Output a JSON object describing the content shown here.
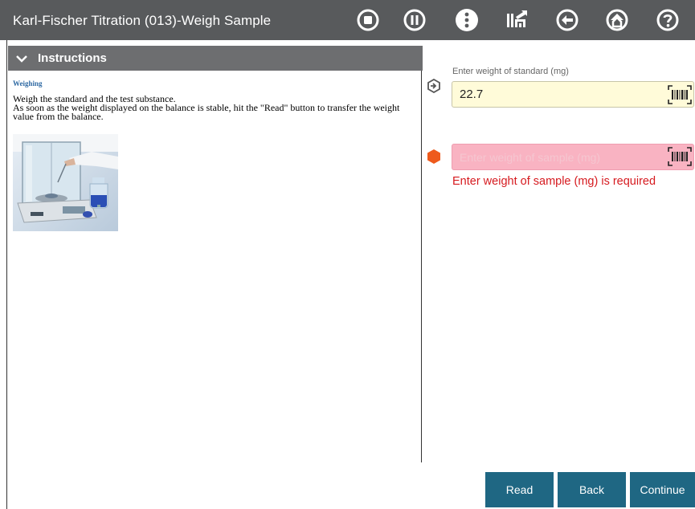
{
  "header": {
    "title": "Karl-Fischer Titration (013)-Weigh Sample",
    "icons": [
      "stop-icon",
      "pause-icon",
      "more-icon",
      "results-icon",
      "back-icon",
      "home-icon",
      "help-icon"
    ]
  },
  "instructions": {
    "header_label": "Instructions",
    "subheading": "Weighing",
    "line1": "Weigh the standard and the test substance.",
    "line2": "As soon as the weight displayed on the balance is stable, hit the \"Read\" button to transfer the weight value from the balance."
  },
  "standard_field": {
    "label": "Enter weight of standard (mg)",
    "value": "22.7"
  },
  "sample_field": {
    "placeholder": "Enter weight of sample (mg)",
    "value": "",
    "error": "Enter weight of sample (mg) is required"
  },
  "buttons": {
    "read": "Read",
    "back": "Back",
    "continue": "Continue"
  },
  "colors": {
    "header_bg": "#585a5c",
    "instructions_bar": "#6d6e70",
    "button_bg": "#1f6783",
    "error_red": "#d61a1f",
    "error_field_bg": "#f9b3c2",
    "active_field_bg": "#fffbd9",
    "error_marker": "#ee5a1c"
  }
}
